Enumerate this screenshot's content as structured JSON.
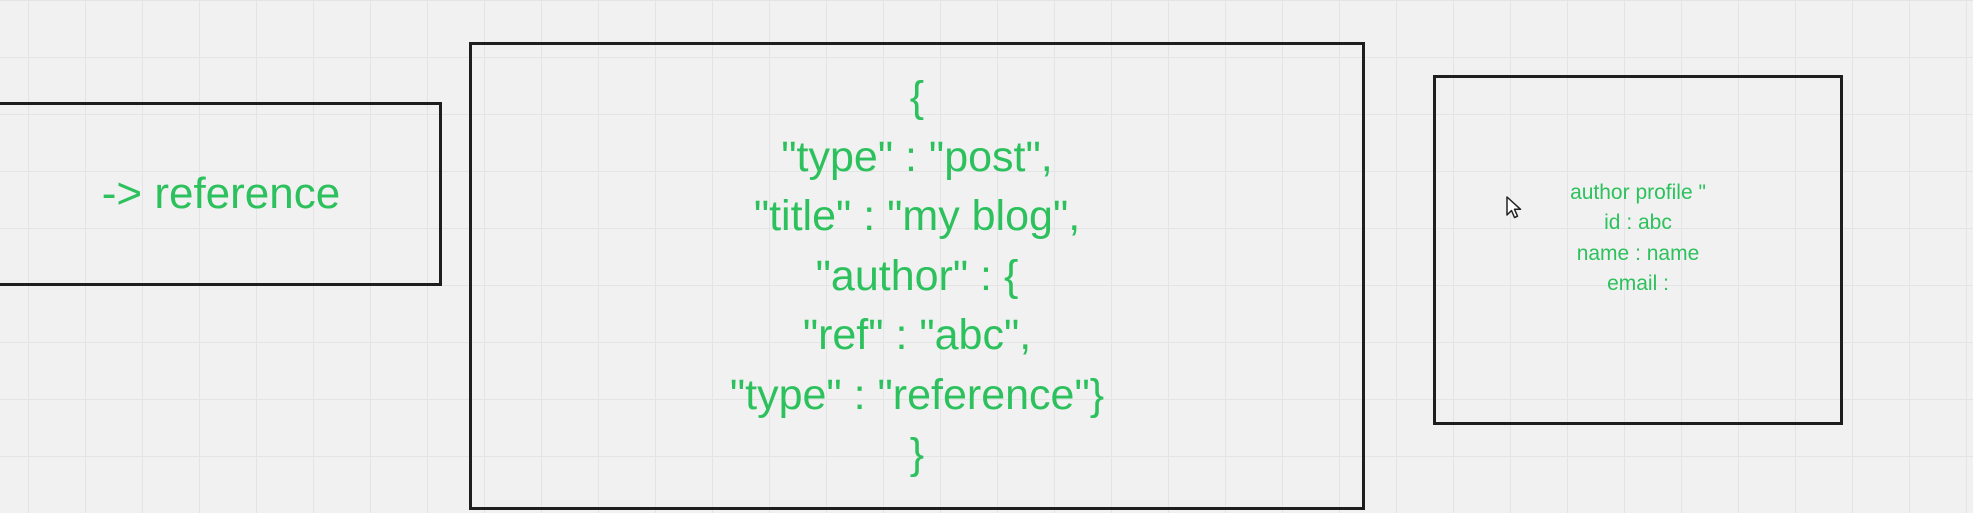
{
  "canvas": {
    "accent_text_color": "#2cc15d",
    "border_color": "#1e1e1e",
    "background_color": "#f1f1f1"
  },
  "nodes": {
    "left": {
      "text": "-> reference"
    },
    "center": {
      "lines": [
        "{",
        "\"type\" : \"post\",",
        "\"title\" : \"my blog\",",
        "\"author\" : {",
        "\"ref\" : \"abc\",",
        "\"type\" : \"reference\"}",
        "}"
      ]
    },
    "right": {
      "lines": [
        "author profile \"",
        "id : abc",
        "name : name",
        "email :"
      ]
    }
  },
  "cursor": {
    "icon": "mouse-pointer-icon"
  }
}
